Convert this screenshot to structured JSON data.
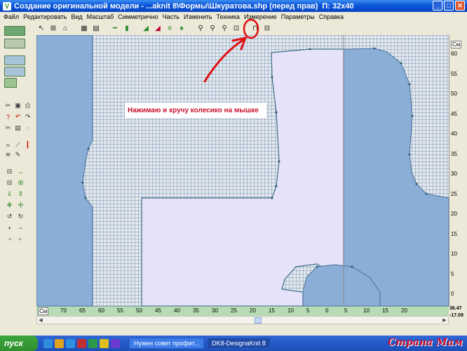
{
  "window": {
    "title": "Создание оригинальной модели - ...aknit 8\\Формы\\Шкуратова.shp (перед прав)",
    "gauge": "П: 32x40"
  },
  "menu": [
    "Файл",
    "Редактировать",
    "Вид",
    "Масштаб",
    "Симметрично",
    "Часть",
    "Изменить",
    "Техника",
    "Измерение",
    "Параметры",
    "Справка"
  ],
  "annotation": {
    "text": "Нажимаю и кручу колесико на мышке",
    "color": "#c8102e"
  },
  "vertical_ruler": {
    "unit": "См",
    "ticks": [
      "60",
      "55",
      "50",
      "45",
      "40",
      "35",
      "30",
      "25",
      "20",
      "15",
      "10",
      "5",
      "0"
    ]
  },
  "horizontal_ruler": {
    "unit": "См",
    "ticks": [
      "70",
      "65",
      "60",
      "55",
      "50",
      "45",
      "40",
      "35",
      "30",
      "25",
      "20",
      "15",
      "10",
      "5",
      "0",
      "5",
      "10",
      "15",
      "20"
    ]
  },
  "coordinates": {
    "x": "36.47",
    "y": "-17.09"
  },
  "taskbar": {
    "start": "пуск",
    "tasks": [
      {
        "label": "Нужен совет профит...",
        "active": false
      },
      {
        "label": "DK8-DesignaKnit 8",
        "active": true
      }
    ]
  },
  "watermark": "Страна Мам",
  "colors": {
    "pattern_fill": "#e6e2fa",
    "mirror_fill": "#8aaed6",
    "grid_bg": "#e3e8ee",
    "accent": "#c8102e"
  }
}
